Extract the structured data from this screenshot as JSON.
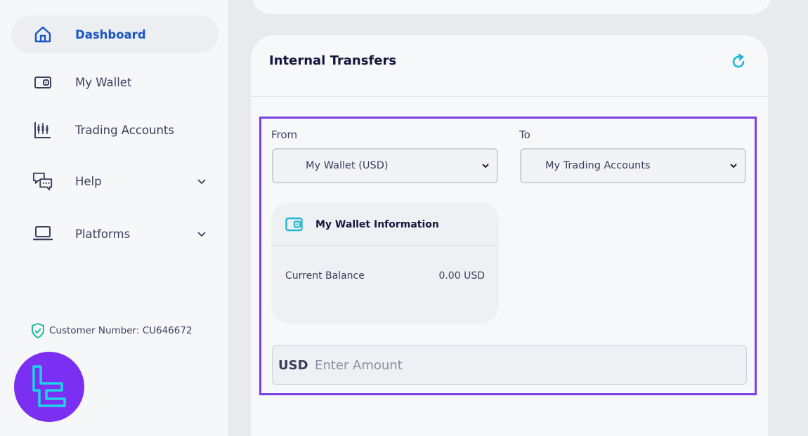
{
  "sidebar": {
    "items": [
      {
        "label": "Dashboard",
        "icon": "home-icon",
        "active": true
      },
      {
        "label": "My Wallet",
        "icon": "wallet-icon"
      },
      {
        "label": "Trading Accounts",
        "icon": "candlestick-icon"
      },
      {
        "label": "Help",
        "icon": "chat-icon",
        "expandable": true
      },
      {
        "label": "Platforms",
        "icon": "laptop-icon",
        "expandable": true
      }
    ],
    "customer_number": "Customer Number: CU646672"
  },
  "transfer": {
    "title": "Internal Transfers",
    "from_label": "From",
    "from_value": "My Wallet (USD)",
    "to_label": "To",
    "to_value": "My Trading Accounts",
    "wallet_info": {
      "title": "My Wallet Information",
      "balance_label": "Current Balance",
      "balance_value": "0.00 USD"
    },
    "amount": {
      "currency": "USD",
      "placeholder": "Enter Amount",
      "value": ""
    }
  },
  "colors": {
    "accent": "#1a56c4",
    "highlight": "#7b3fe4",
    "icon_teal": "#1fb8d6",
    "logo_purple": "#7b2ff2"
  }
}
